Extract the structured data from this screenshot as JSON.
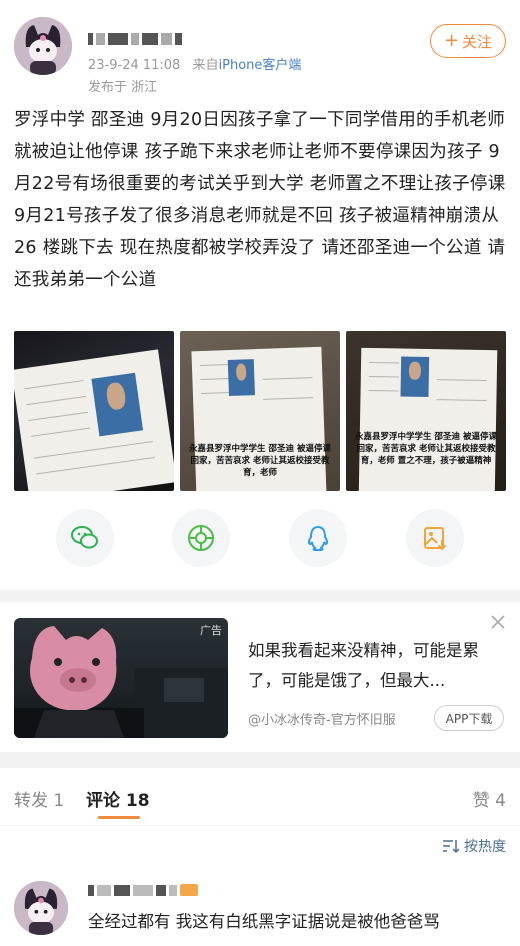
{
  "post": {
    "author_name": "",
    "timestamp": "23-9-24 11:08",
    "via_prefix": "来自",
    "client": "iPhone客户端",
    "location": "发布于 浙江",
    "follow_label": "关注",
    "text": "罗浮中学 邵圣迪 9月20日因孩子拿了一下同学借用的手机老师就被迫让他停课 孩子跪下来求老师让老师不要停课因为孩子 9月22号有场很重要的考试关乎到大学 老师置之不理让孩子停课 9月21号孩子发了很多消息老师就是不回 孩子被逼精神崩溃从 26 楼跳下去 现在热度都被学校弄没了 请还邵圣迪一个公道 请还我弟弟一个公道",
    "images": [
      {
        "caption": ""
      },
      {
        "caption": "永嘉县罗浮中学学生 邵圣迪 被逼停课回家，苦苦哀求 老师让其返校接受教育，老师"
      },
      {
        "caption": "永嘉县罗浮中学学生 邵圣迪 被逼停课回家，苦苦哀求 老师让其返校接受教育，老师 置之不理，孩子被逼精神"
      }
    ]
  },
  "share": {
    "icons": [
      "wechat-icon",
      "moments-icon",
      "qq-icon",
      "save-image-icon"
    ],
    "colors": {
      "wechat": "#2bb24c",
      "moments": "#4cbd45",
      "qq": "#2f9ce8",
      "save": "#f0a43b"
    }
  },
  "ad": {
    "tag": "广告",
    "text": "如果我看起来没精神，可能是累了，可能是饿了，但最大...",
    "source": "@小冰冰传奇-官方怀旧服",
    "app_button": "APP下载"
  },
  "tabs": {
    "repost": "转发 1",
    "comments": "评论 18",
    "likes": "赞 4"
  },
  "sort": {
    "label": "按热度"
  },
  "comment": {
    "text": "全经过都有 我这有白纸黑字证据说是被他爸爸骂"
  },
  "colors": {
    "accent": "#f08a3c",
    "link": "#4a7fc1"
  }
}
